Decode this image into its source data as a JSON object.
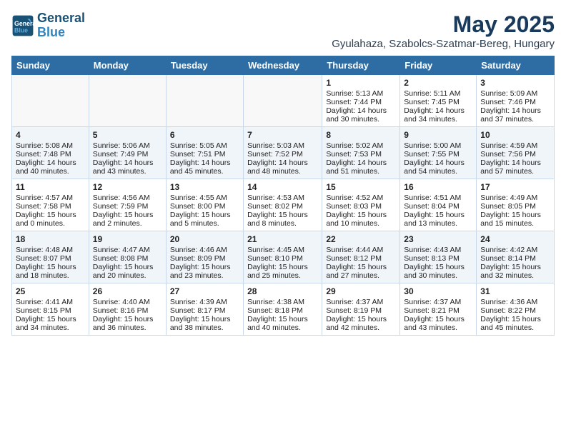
{
  "header": {
    "logo_line1": "General",
    "logo_line2": "Blue",
    "month": "May 2025",
    "location": "Gyulahaza, Szabolcs-Szatmar-Bereg, Hungary"
  },
  "weekdays": [
    "Sunday",
    "Monday",
    "Tuesday",
    "Wednesday",
    "Thursday",
    "Friday",
    "Saturday"
  ],
  "weeks": [
    [
      {
        "day": "",
        "content": ""
      },
      {
        "day": "",
        "content": ""
      },
      {
        "day": "",
        "content": ""
      },
      {
        "day": "",
        "content": ""
      },
      {
        "day": "1",
        "content": "Sunrise: 5:13 AM\nSunset: 7:44 PM\nDaylight: 14 hours\nand 30 minutes."
      },
      {
        "day": "2",
        "content": "Sunrise: 5:11 AM\nSunset: 7:45 PM\nDaylight: 14 hours\nand 34 minutes."
      },
      {
        "day": "3",
        "content": "Sunrise: 5:09 AM\nSunset: 7:46 PM\nDaylight: 14 hours\nand 37 minutes."
      }
    ],
    [
      {
        "day": "4",
        "content": "Sunrise: 5:08 AM\nSunset: 7:48 PM\nDaylight: 14 hours\nand 40 minutes."
      },
      {
        "day": "5",
        "content": "Sunrise: 5:06 AM\nSunset: 7:49 PM\nDaylight: 14 hours\nand 43 minutes."
      },
      {
        "day": "6",
        "content": "Sunrise: 5:05 AM\nSunset: 7:51 PM\nDaylight: 14 hours\nand 45 minutes."
      },
      {
        "day": "7",
        "content": "Sunrise: 5:03 AM\nSunset: 7:52 PM\nDaylight: 14 hours\nand 48 minutes."
      },
      {
        "day": "8",
        "content": "Sunrise: 5:02 AM\nSunset: 7:53 PM\nDaylight: 14 hours\nand 51 minutes."
      },
      {
        "day": "9",
        "content": "Sunrise: 5:00 AM\nSunset: 7:55 PM\nDaylight: 14 hours\nand 54 minutes."
      },
      {
        "day": "10",
        "content": "Sunrise: 4:59 AM\nSunset: 7:56 PM\nDaylight: 14 hours\nand 57 minutes."
      }
    ],
    [
      {
        "day": "11",
        "content": "Sunrise: 4:57 AM\nSunset: 7:58 PM\nDaylight: 15 hours\nand 0 minutes."
      },
      {
        "day": "12",
        "content": "Sunrise: 4:56 AM\nSunset: 7:59 PM\nDaylight: 15 hours\nand 2 minutes."
      },
      {
        "day": "13",
        "content": "Sunrise: 4:55 AM\nSunset: 8:00 PM\nDaylight: 15 hours\nand 5 minutes."
      },
      {
        "day": "14",
        "content": "Sunrise: 4:53 AM\nSunset: 8:02 PM\nDaylight: 15 hours\nand 8 minutes."
      },
      {
        "day": "15",
        "content": "Sunrise: 4:52 AM\nSunset: 8:03 PM\nDaylight: 15 hours\nand 10 minutes."
      },
      {
        "day": "16",
        "content": "Sunrise: 4:51 AM\nSunset: 8:04 PM\nDaylight: 15 hours\nand 13 minutes."
      },
      {
        "day": "17",
        "content": "Sunrise: 4:49 AM\nSunset: 8:05 PM\nDaylight: 15 hours\nand 15 minutes."
      }
    ],
    [
      {
        "day": "18",
        "content": "Sunrise: 4:48 AM\nSunset: 8:07 PM\nDaylight: 15 hours\nand 18 minutes."
      },
      {
        "day": "19",
        "content": "Sunrise: 4:47 AM\nSunset: 8:08 PM\nDaylight: 15 hours\nand 20 minutes."
      },
      {
        "day": "20",
        "content": "Sunrise: 4:46 AM\nSunset: 8:09 PM\nDaylight: 15 hours\nand 23 minutes."
      },
      {
        "day": "21",
        "content": "Sunrise: 4:45 AM\nSunset: 8:10 PM\nDaylight: 15 hours\nand 25 minutes."
      },
      {
        "day": "22",
        "content": "Sunrise: 4:44 AM\nSunset: 8:12 PM\nDaylight: 15 hours\nand 27 minutes."
      },
      {
        "day": "23",
        "content": "Sunrise: 4:43 AM\nSunset: 8:13 PM\nDaylight: 15 hours\nand 30 minutes."
      },
      {
        "day": "24",
        "content": "Sunrise: 4:42 AM\nSunset: 8:14 PM\nDaylight: 15 hours\nand 32 minutes."
      }
    ],
    [
      {
        "day": "25",
        "content": "Sunrise: 4:41 AM\nSunset: 8:15 PM\nDaylight: 15 hours\nand 34 minutes."
      },
      {
        "day": "26",
        "content": "Sunrise: 4:40 AM\nSunset: 8:16 PM\nDaylight: 15 hours\nand 36 minutes."
      },
      {
        "day": "27",
        "content": "Sunrise: 4:39 AM\nSunset: 8:17 PM\nDaylight: 15 hours\nand 38 minutes."
      },
      {
        "day": "28",
        "content": "Sunrise: 4:38 AM\nSunset: 8:18 PM\nDaylight: 15 hours\nand 40 minutes."
      },
      {
        "day": "29",
        "content": "Sunrise: 4:37 AM\nSunset: 8:19 PM\nDaylight: 15 hours\nand 42 minutes."
      },
      {
        "day": "30",
        "content": "Sunrise: 4:37 AM\nSunset: 8:21 PM\nDaylight: 15 hours\nand 43 minutes."
      },
      {
        "day": "31",
        "content": "Sunrise: 4:36 AM\nSunset: 8:22 PM\nDaylight: 15 hours\nand 45 minutes."
      }
    ]
  ]
}
